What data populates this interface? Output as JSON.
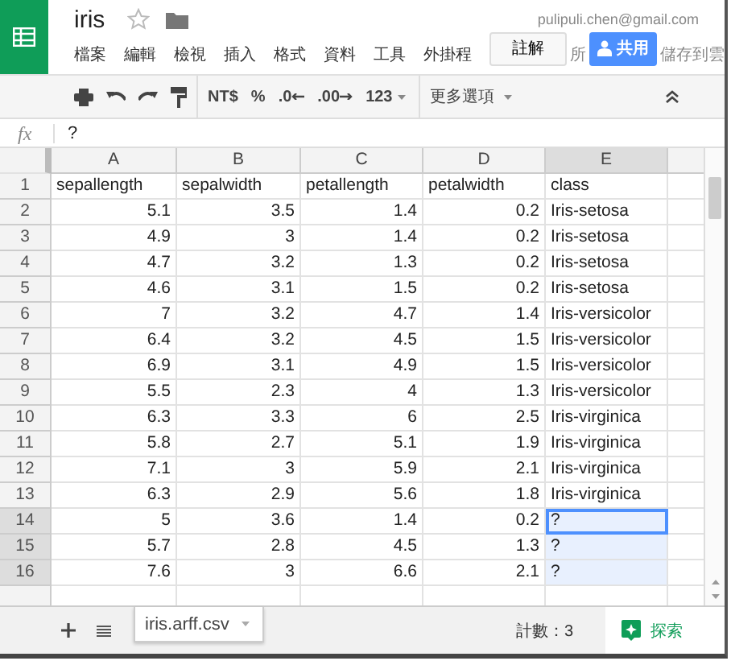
{
  "app": {
    "title": "iris",
    "starred": false,
    "account": "pulipuli.chen@gmail.com",
    "menu": [
      "檔案",
      "編輯",
      "檢視",
      "插入",
      "格式",
      "資料",
      "工具",
      "外掛程"
    ],
    "comments_button": "註解",
    "menu_hidden_part": "所",
    "share_button": "共用",
    "save_status": "儲存到雲"
  },
  "toolbar": {
    "currency": "NT$",
    "percent": "%",
    "decrease_decimals": ".0",
    "increase_decimals": ".00",
    "number_format": "123",
    "more": "更多選項"
  },
  "formula_bar": {
    "label": "fx",
    "value": "?"
  },
  "sheet": {
    "columns": [
      {
        "label": "A",
        "kind": "number",
        "selected": false
      },
      {
        "label": "B",
        "kind": "number",
        "selected": false
      },
      {
        "label": "C",
        "kind": "number",
        "selected": false
      },
      {
        "label": "D",
        "kind": "number",
        "selected": false
      },
      {
        "label": "E",
        "kind": "text",
        "selected": true
      }
    ],
    "rows": [
      {
        "number": "1",
        "kind": "header",
        "selected": false,
        "active": false,
        "cells": [
          "sepallength",
          "sepalwidth",
          "petallength",
          "petalwidth",
          "class"
        ]
      },
      {
        "number": "2",
        "kind": "data",
        "selected": false,
        "active": false,
        "cells": [
          "5.1",
          "3.5",
          "1.4",
          "0.2",
          "Iris-setosa"
        ]
      },
      {
        "number": "3",
        "kind": "data",
        "selected": false,
        "active": false,
        "cells": [
          "4.9",
          "3",
          "1.4",
          "0.2",
          "Iris-setosa"
        ]
      },
      {
        "number": "4",
        "kind": "data",
        "selected": false,
        "active": false,
        "cells": [
          "4.7",
          "3.2",
          "1.3",
          "0.2",
          "Iris-setosa"
        ]
      },
      {
        "number": "5",
        "kind": "data",
        "selected": false,
        "active": false,
        "cells": [
          "4.6",
          "3.1",
          "1.5",
          "0.2",
          "Iris-setosa"
        ]
      },
      {
        "number": "6",
        "kind": "data",
        "selected": false,
        "active": false,
        "cells": [
          "7",
          "3.2",
          "4.7",
          "1.4",
          "Iris-versicolor"
        ]
      },
      {
        "number": "7",
        "kind": "data",
        "selected": false,
        "active": false,
        "cells": [
          "6.4",
          "3.2",
          "4.5",
          "1.5",
          "Iris-versicolor"
        ]
      },
      {
        "number": "8",
        "kind": "data",
        "selected": false,
        "active": false,
        "cells": [
          "6.9",
          "3.1",
          "4.9",
          "1.5",
          "Iris-versicolor"
        ]
      },
      {
        "number": "9",
        "kind": "data",
        "selected": false,
        "active": false,
        "cells": [
          "5.5",
          "2.3",
          "4",
          "1.3",
          "Iris-versicolor"
        ]
      },
      {
        "number": "10",
        "kind": "data",
        "selected": false,
        "active": false,
        "cells": [
          "6.3",
          "3.3",
          "6",
          "2.5",
          "Iris-virginica"
        ]
      },
      {
        "number": "11",
        "kind": "data",
        "selected": false,
        "active": false,
        "cells": [
          "5.8",
          "2.7",
          "5.1",
          "1.9",
          "Iris-virginica"
        ]
      },
      {
        "number": "12",
        "kind": "data",
        "selected": false,
        "active": false,
        "cells": [
          "7.1",
          "3",
          "5.9",
          "2.1",
          "Iris-virginica"
        ]
      },
      {
        "number": "13",
        "kind": "data",
        "selected": false,
        "active": false,
        "cells": [
          "6.3",
          "2.9",
          "5.6",
          "1.8",
          "Iris-virginica"
        ]
      },
      {
        "number": "14",
        "kind": "data",
        "selected": true,
        "active": true,
        "cells": [
          "5",
          "3.6",
          "1.4",
          "0.2",
          "?"
        ]
      },
      {
        "number": "15",
        "kind": "data",
        "selected": true,
        "active": false,
        "cells": [
          "5.7",
          "2.8",
          "4.5",
          "1.3",
          "?"
        ]
      },
      {
        "number": "16",
        "kind": "data",
        "selected": true,
        "active": false,
        "cells": [
          "7.6",
          "3",
          "6.6",
          "2.1",
          "?"
        ]
      }
    ]
  },
  "footer": {
    "sheet_tab": "iris.arff.csv",
    "status": "計數：3",
    "explore": "探索"
  }
}
